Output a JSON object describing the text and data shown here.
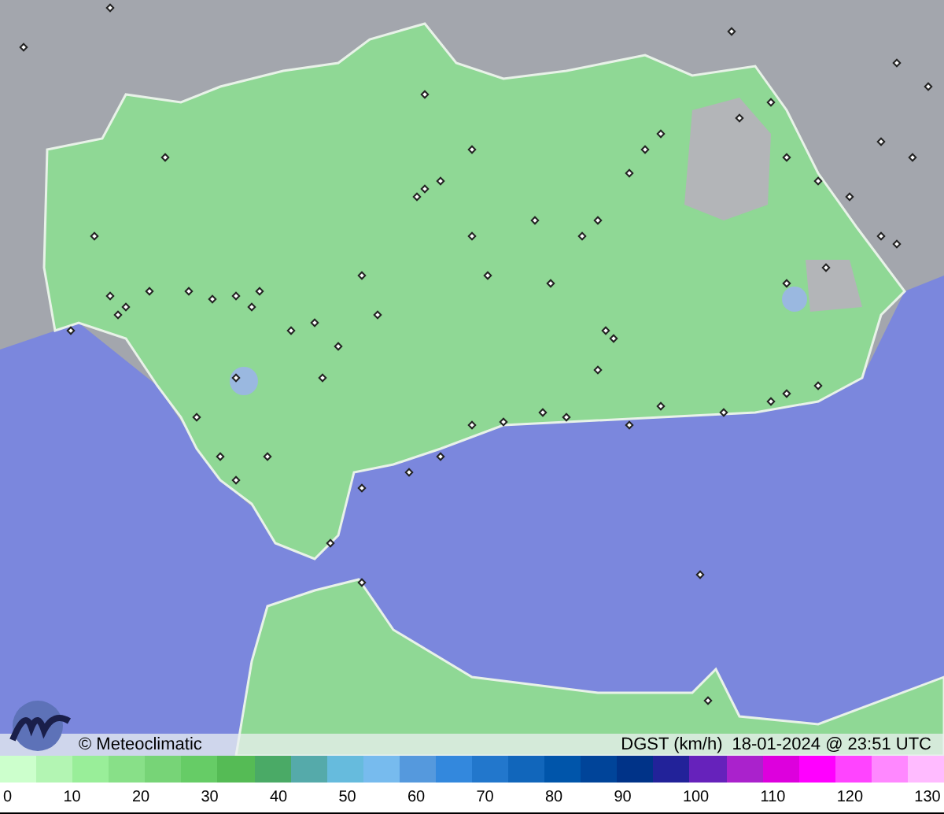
{
  "map": {
    "credit": "© Meteoclimatic",
    "variable": "DGST (km/h)",
    "timestamp": "18-01-2024 @ 23:51 UTC"
  },
  "legend": {
    "bins": [
      {
        "color": "#ccffcc"
      },
      {
        "color": "#b3f5b3"
      },
      {
        "color": "#99ee99"
      },
      {
        "color": "#88e088"
      },
      {
        "color": "#77d477"
      },
      {
        "color": "#66cc66"
      },
      {
        "color": "#55bb55"
      },
      {
        "color": "#4aaa66"
      },
      {
        "color": "#55aaaa"
      },
      {
        "color": "#66bbdd"
      },
      {
        "color": "#77bbee"
      },
      {
        "color": "#5599dd"
      },
      {
        "color": "#3388dd"
      },
      {
        "color": "#2277cc"
      },
      {
        "color": "#1166bb"
      },
      {
        "color": "#0055aa"
      },
      {
        "color": "#004499"
      },
      {
        "color": "#003388"
      },
      {
        "color": "#222299"
      },
      {
        "color": "#6622bb"
      },
      {
        "color": "#aa22cc"
      },
      {
        "color": "#dd00dd"
      },
      {
        "color": "#ff00ff"
      },
      {
        "color": "#ff44ff"
      },
      {
        "color": "#ff88ff"
      },
      {
        "color": "#ffbbff"
      }
    ],
    "ticks": [
      "0",
      "10",
      "20",
      "30",
      "40",
      "50",
      "60",
      "70",
      "80",
      "90",
      "100",
      "110",
      "120",
      "130"
    ]
  }
}
